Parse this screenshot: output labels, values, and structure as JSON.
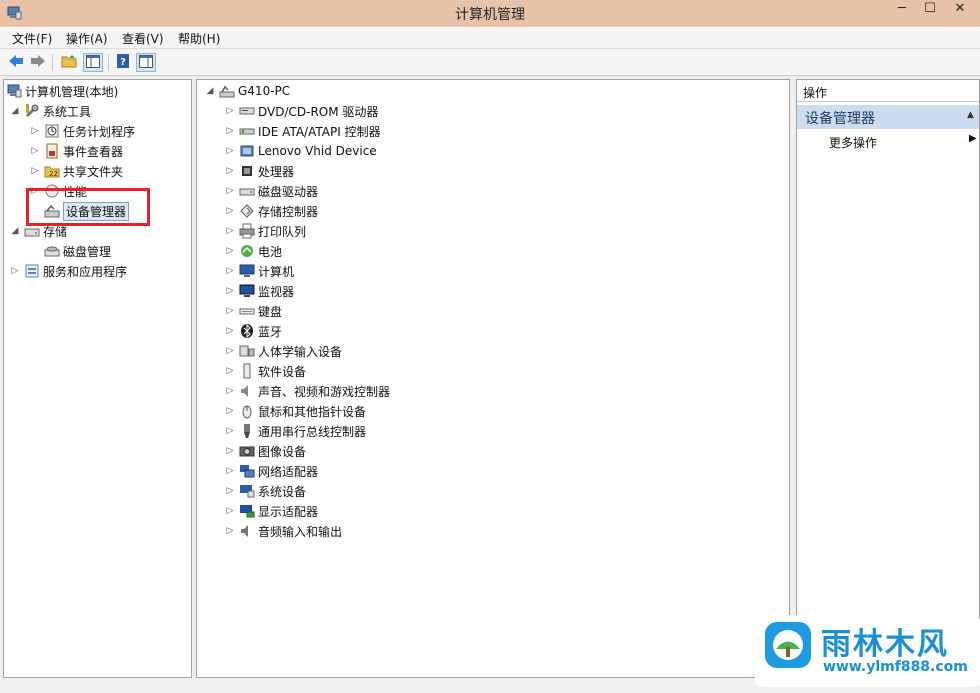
{
  "window": {
    "title": "计算机管理",
    "minimize": "─",
    "maximize": "☐",
    "close": "✕"
  },
  "menu": [
    "文件(F)",
    "操作(A)",
    "查看(V)",
    "帮助(H)"
  ],
  "tree": {
    "root": "计算机管理(本地)",
    "system_tools": "系统工具",
    "task_scheduler": "任务计划程序",
    "event_viewer": "事件查看器",
    "shared_folders": "共享文件夹",
    "performance": "性能",
    "device_manager": "设备管理器",
    "storage": "存储",
    "disk_management": "磁盘管理",
    "services_apps": "服务和应用程序"
  },
  "devices": {
    "computer_name": "G410-PC",
    "categories": [
      {
        "label": "DVD/CD-ROM 驱动器",
        "icon": "dvd-drive-icon"
      },
      {
        "label": "IDE ATA/ATAPI 控制器",
        "icon": "ide-controller-icon"
      },
      {
        "label": "Lenovo Vhid Device",
        "icon": "hid-device-icon"
      },
      {
        "label": "处理器",
        "icon": "processor-icon"
      },
      {
        "label": "磁盘驱动器",
        "icon": "disk-drive-icon"
      },
      {
        "label": "存储控制器",
        "icon": "storage-controller-icon"
      },
      {
        "label": "打印队列",
        "icon": "printer-icon"
      },
      {
        "label": "电池",
        "icon": "battery-icon"
      },
      {
        "label": "计算机",
        "icon": "computer-icon"
      },
      {
        "label": "监视器",
        "icon": "monitor-icon"
      },
      {
        "label": "键盘",
        "icon": "keyboard-icon"
      },
      {
        "label": "蓝牙",
        "icon": "bluetooth-icon"
      },
      {
        "label": "人体学输入设备",
        "icon": "hid-input-icon"
      },
      {
        "label": "软件设备",
        "icon": "software-device-icon"
      },
      {
        "label": "声音、视频和游戏控制器",
        "icon": "sound-icon"
      },
      {
        "label": "鼠标和其他指针设备",
        "icon": "mouse-icon"
      },
      {
        "label": "通用串行总线控制器",
        "icon": "usb-icon"
      },
      {
        "label": "图像设备",
        "icon": "imaging-device-icon"
      },
      {
        "label": "网络适配器",
        "icon": "network-adapter-icon"
      },
      {
        "label": "系统设备",
        "icon": "system-device-icon"
      },
      {
        "label": "显示适配器",
        "icon": "display-adapter-icon"
      },
      {
        "label": "音频输入和输出",
        "icon": "audio-io-icon"
      }
    ]
  },
  "actions": {
    "header": "操作",
    "section": "设备管理器",
    "more": "更多操作"
  },
  "watermark": {
    "brand": "雨林木风",
    "url": "www.ylmf888.com"
  },
  "colors": {
    "titlebar": "#e7c2a9",
    "selection": "#dbe9f7",
    "highlight": "#e5222a",
    "brand": "#1b8fd6"
  }
}
